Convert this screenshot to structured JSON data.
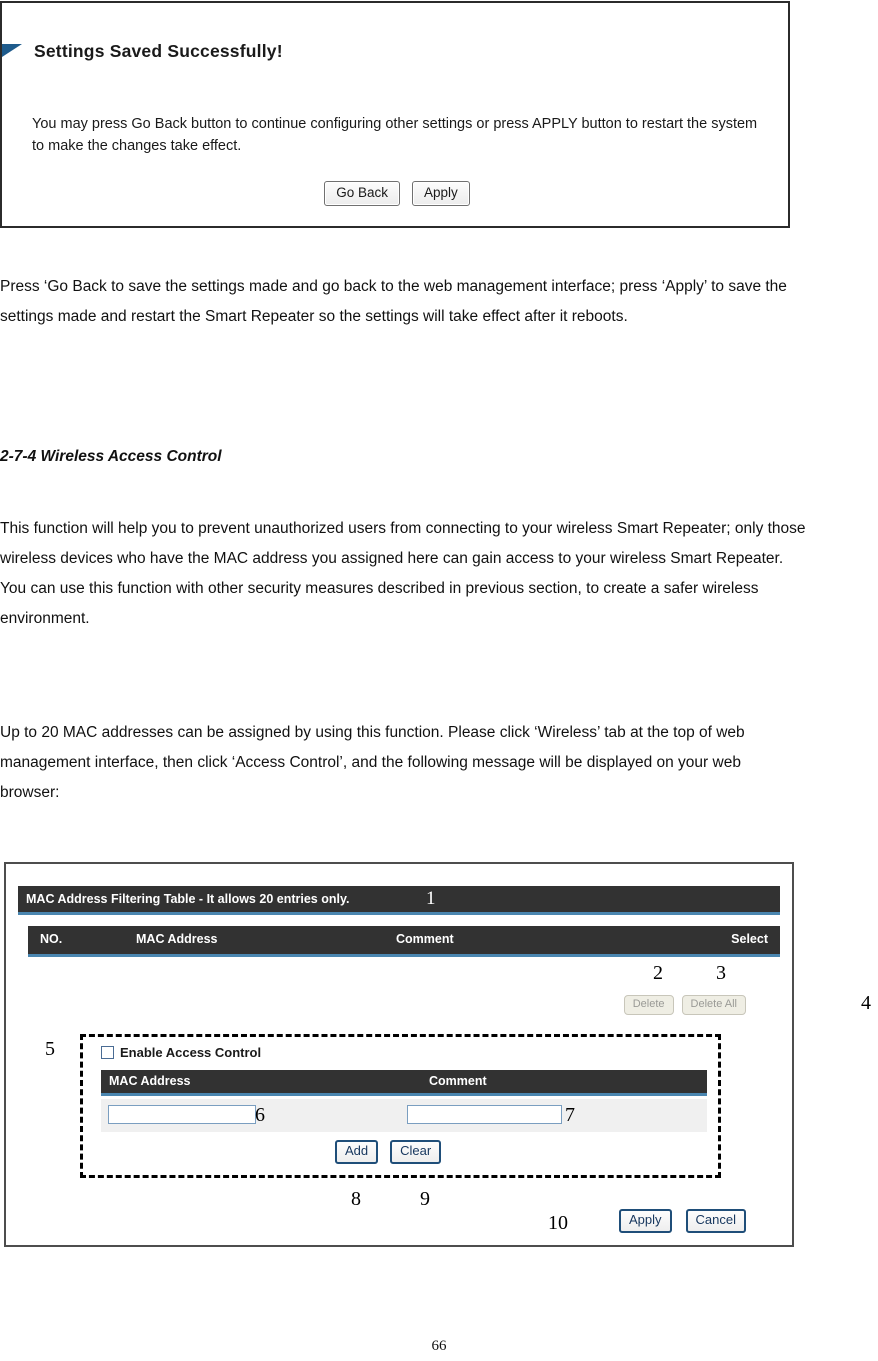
{
  "saved_panel": {
    "arrow_icon": "triangle-marker",
    "title": "Settings Saved Successfully!",
    "body": "You may press Go Back button to continue configuring other settings or press APPLY button to restart the system to make the changes take effect.",
    "buttons": {
      "go_back": "Go Back",
      "apply": "Apply"
    }
  },
  "manual": {
    "paragraph_1": "Press ‘Go Back to save the settings made and go back to the web management interface; press ‘Apply’ to save the settings made and restart the Smart Repeater so the settings will take effect after it reboots.",
    "section_heading": "2-7-4 Wireless Access Control",
    "paragraph_2": "This function will help you to prevent unauthorized users from connecting to your wireless Smart Repeater; only those wireless devices who have the MAC address you assigned here can gain access to your wireless Smart Repeater. You can use this function with other security measures described in previous section, to create a safer wireless environment.",
    "paragraph_3": "Up to 20 MAC addresses can be assigned by using this function. Please click ‘Wireless’ tab at the top of web management interface, then click ‘Access Control’, and the following message will be displayed on your web browser:",
    "page_number": "66"
  },
  "acl_panel": {
    "title": "MAC Address Filtering Table - It allows 20 entries only.",
    "columns": {
      "no": "NO.",
      "mac_address": "MAC Address",
      "comment": "Comment",
      "select": "Select"
    },
    "rows": [],
    "delete_buttons": {
      "delete": "Delete",
      "delete_all": "Delete All"
    },
    "enable_access_control": {
      "label": "Enable Access Control",
      "checked": false
    },
    "entry_form": {
      "header_mac": "MAC Address",
      "header_comment": "Comment",
      "mac_value": "",
      "mac_placeholder": "",
      "comment_value": "",
      "comment_placeholder": "",
      "add_label": "Add",
      "clear_label": "Clear"
    },
    "footer_buttons": {
      "apply": "Apply",
      "cancel": "Cancel"
    }
  },
  "callouts": {
    "c1": "1",
    "c2": "2",
    "c3": "3",
    "c4": "4",
    "c5": "5",
    "c6": "6",
    "c7": "7",
    "c8": "8",
    "c9": "9",
    "c10": "10"
  },
  "colors": {
    "header_bar": "#323232",
    "accent_underline": "#4a86b0",
    "panel_border": "#4d4d4d",
    "arrow_blue": "#1e5b8c",
    "button_blue_border": "#1f4e79",
    "row_background": "#f0f0f0"
  }
}
